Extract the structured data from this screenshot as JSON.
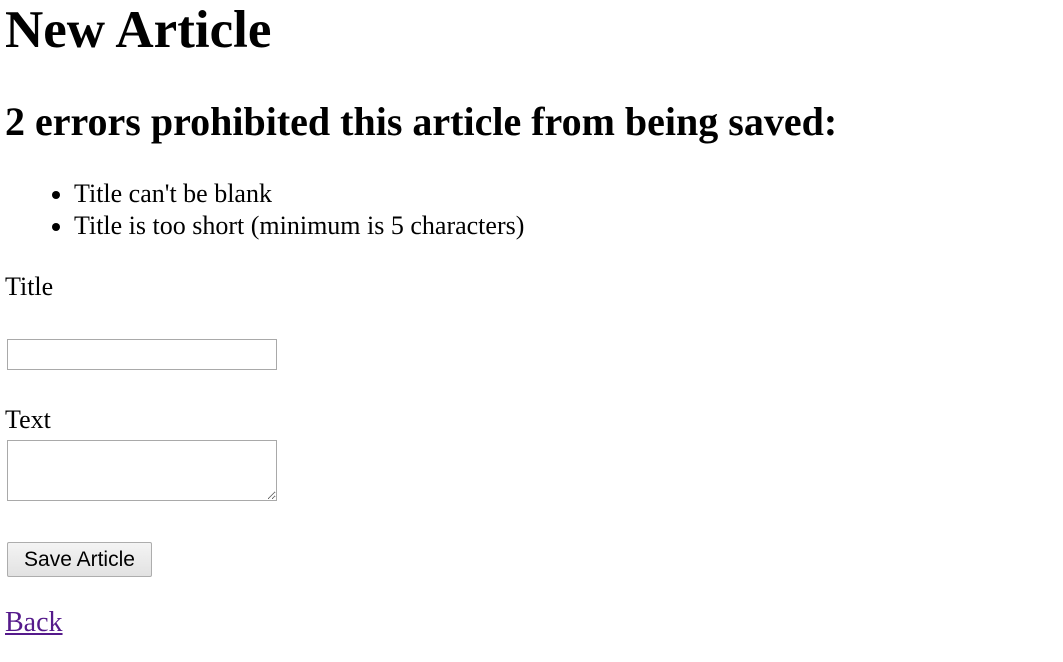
{
  "page": {
    "heading": "New Article"
  },
  "error_explanation": {
    "heading": "2 errors prohibited this article from being saved:",
    "messages": [
      "Title can't be blank",
      "Title is too short (minimum is 5 characters)"
    ]
  },
  "form": {
    "title_label": "Title",
    "title_value": "",
    "text_label": "Text",
    "text_value": "",
    "submit_label": "Save Article"
  },
  "footer": {
    "back_link": "Back"
  },
  "colors": {
    "link_visited": "#551a8b",
    "input_border": "#a9a9a9"
  }
}
